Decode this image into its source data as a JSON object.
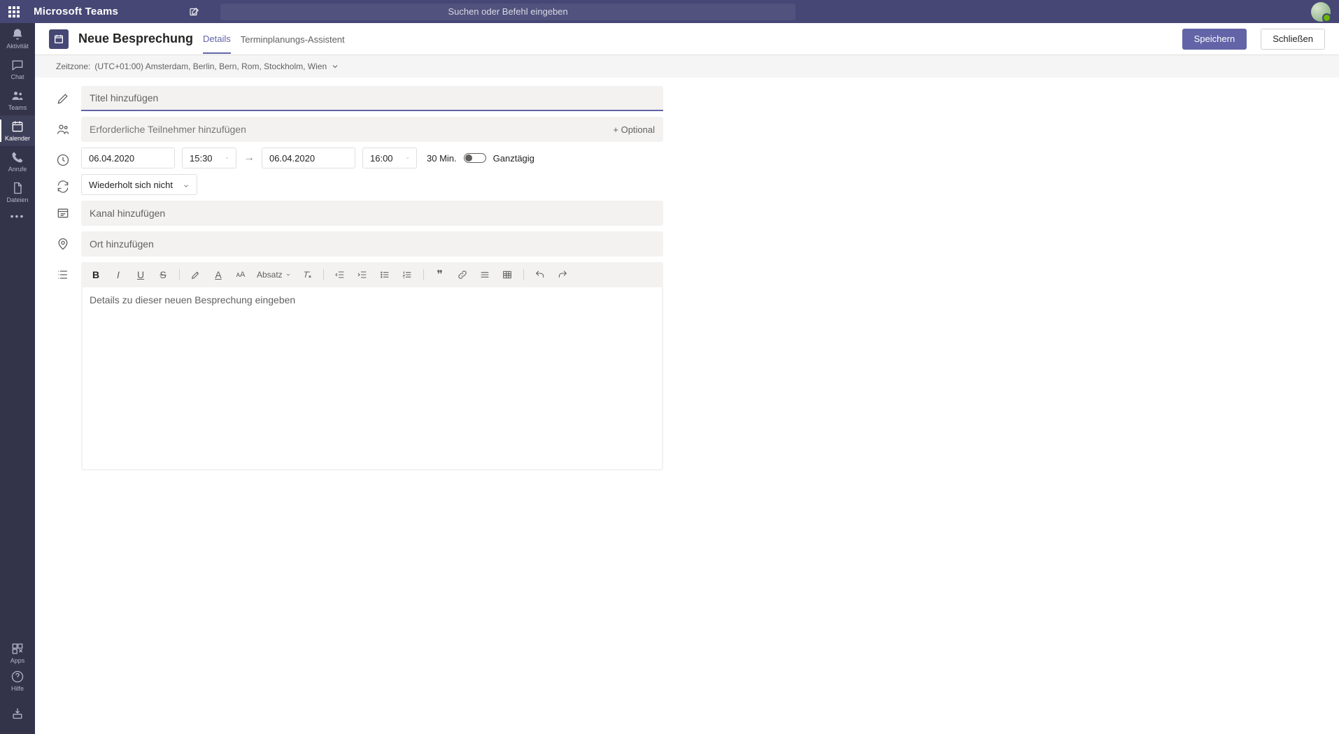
{
  "titlebar": {
    "brand": "Microsoft Teams",
    "search_placeholder": "Suchen oder Befehl eingeben"
  },
  "rail": {
    "activity": "Aktivität",
    "chat": "Chat",
    "teams": "Teams",
    "calendar": "Kalender",
    "calls": "Anrufe",
    "files": "Dateien",
    "apps": "Apps",
    "help": "Hilfe"
  },
  "pagebar": {
    "title": "Neue Besprechung",
    "tab_details": "Details",
    "tab_scheduler": "Terminplanungs-Assistent",
    "save": "Speichern",
    "close": "Schließen"
  },
  "timezone": {
    "label": "Zeitzone:",
    "value": "(UTC+01:00) Amsterdam, Berlin, Bern, Rom, Stockholm, Wien"
  },
  "fields": {
    "title_placeholder": "Titel hinzufügen",
    "attendees_placeholder": "Erforderliche Teilnehmer hinzufügen",
    "optional_label": "+ Optional",
    "start_date": "06.04.2020",
    "start_time": "15:30",
    "end_date": "06.04.2020",
    "end_time": "16:00",
    "duration": "30 Min.",
    "allday": "Ganztägig",
    "repeat": "Wiederholt sich nicht",
    "channel_placeholder": "Kanal hinzufügen",
    "location_placeholder": "Ort hinzufügen",
    "description_placeholder": "Details zu dieser neuen Besprechung eingeben",
    "paragraph_label": "Absatz"
  }
}
